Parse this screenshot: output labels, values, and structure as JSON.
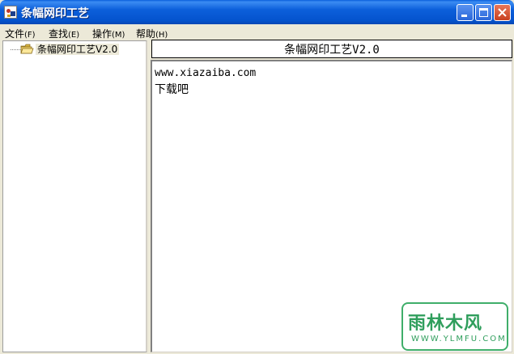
{
  "window": {
    "title": "条幅网印工艺"
  },
  "menu": {
    "items": [
      {
        "label": "文件",
        "key": "(F)"
      },
      {
        "label": "查找",
        "key": "(E)"
      },
      {
        "label": "操作",
        "key": "(M)"
      },
      {
        "label": "帮助",
        "key": "(H)"
      }
    ]
  },
  "tree": {
    "root_label": "条幅网印工艺V2.0"
  },
  "header": {
    "title": "条幅网印工艺V2.0"
  },
  "content": {
    "line1": "www.xiazaiba.com",
    "line2": "下载吧"
  },
  "watermark": {
    "brand": "雨林木风",
    "url": "WWW.YLMFU.COM"
  },
  "colors": {
    "titlebar": "#0453cd",
    "face": "#ece9d8",
    "watermark": "#2f9e5c"
  }
}
